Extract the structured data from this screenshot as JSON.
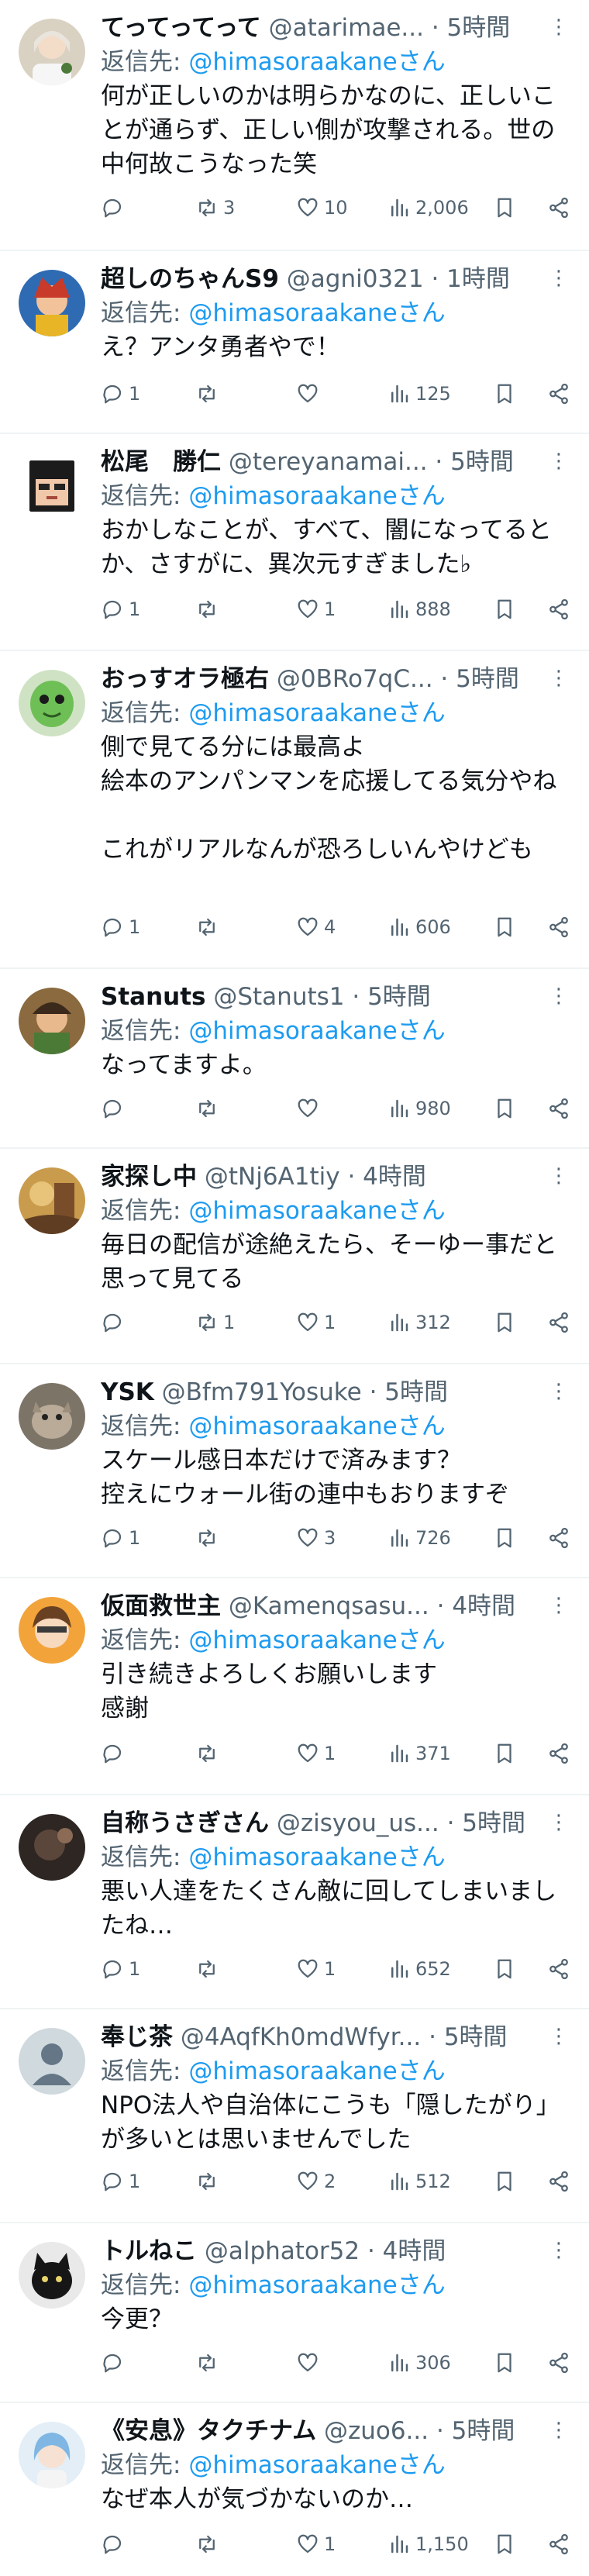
{
  "replies": [
    {
      "name": "てってってって",
      "handle": "@atarimae...",
      "time": "5時間",
      "reply_prefix": "返信先: ",
      "reply_to": "@himasoraakaneさん",
      "text": "何が正しいのかは明らかなのに、正しいことが通らず、正しい側が攻撃される。世の中何故こうなった笑",
      "replies": "",
      "retweets": "3",
      "likes": "10",
      "views": "2,006"
    },
    {
      "name": "超しのちゃんS9",
      "handle": "@agni0321",
      "time": "1時間",
      "reply_prefix": "返信先: ",
      "reply_to": "@himasoraakaneさん",
      "text": "え？アンタ勇者やで！",
      "replies": "1",
      "retweets": "",
      "likes": "",
      "views": "125"
    },
    {
      "name": "松尾　勝仁",
      "handle": "@tereyanamai...",
      "time": "5時間",
      "reply_prefix": "返信先: ",
      "reply_to": "@himasoraakaneさん",
      "text": "おかしなことが、すべて、闇になってるとか、さすがに、異次元すぎました♭",
      "replies": "1",
      "retweets": "",
      "likes": "1",
      "views": "888"
    },
    {
      "name": "おっすオラ極右",
      "handle": "@0BRo7qC...",
      "time": "5時間",
      "reply_prefix": "返信先: ",
      "reply_to": "@himasoraakaneさん",
      "text": "側で見てる分には最高よ\n絵本のアンパンマンを応援してる気分やね\n\nこれがリアルなんが恐ろしいんやけども",
      "replies": "1",
      "retweets": "",
      "likes": "4",
      "views": "606"
    },
    {
      "name": "Stanuts",
      "handle": "@Stanuts1",
      "time": "5時間",
      "reply_prefix": "返信先: ",
      "reply_to": "@himasoraakaneさん",
      "text": "なってますよ。",
      "replies": "",
      "retweets": "",
      "likes": "",
      "views": "980"
    },
    {
      "name": "家探し中",
      "handle": "@tNj6A1tiy",
      "time": "4時間",
      "reply_prefix": "返信先: ",
      "reply_to": "@himasoraakaneさん",
      "text": "毎日の配信が途絶えたら、そーゆー事だと思って見てる",
      "replies": "",
      "retweets": "1",
      "likes": "1",
      "views": "312"
    },
    {
      "name": "YSK",
      "handle": "@Bfm791Yosuke",
      "time": "5時間",
      "reply_prefix": "返信先: ",
      "reply_to": "@himasoraakaneさん",
      "text": "スケール感日本だけで済みます？\n控えにウォール街の連中もおりますぞ",
      "replies": "1",
      "retweets": "",
      "likes": "3",
      "views": "726"
    },
    {
      "name": "仮面救世主",
      "handle": "@Kamenqsasu...",
      "time": "4時間",
      "reply_prefix": "返信先: ",
      "reply_to": "@himasoraakaneさん",
      "text": "引き続きよろしくお願いします\n感謝",
      "replies": "",
      "retweets": "",
      "likes": "1",
      "views": "371"
    },
    {
      "name": "自称うさぎさん",
      "handle": "@zisyou_us...",
      "time": "5時間",
      "reply_prefix": "返信先: ",
      "reply_to": "@himasoraakaneさん",
      "text": "悪い人達をたくさん敵に回してしまいましたね…",
      "replies": "1",
      "retweets": "",
      "likes": "1",
      "views": "652"
    },
    {
      "name": "奉じ茶",
      "handle": "@4AqfKh0mdWfyr...",
      "time": "5時間",
      "reply_prefix": "返信先: ",
      "reply_to": "@himasoraakaneさん",
      "text": "NPO法人や自治体にこうも「隠したがり」が多いとは思いませんでした",
      "replies": "1",
      "retweets": "",
      "likes": "2",
      "views": "512"
    },
    {
      "name": "トルねこ",
      "handle": "@alphator52",
      "time": "4時間",
      "reply_prefix": "返信先: ",
      "reply_to": "@himasoraakaneさん",
      "text": "今更？",
      "replies": "",
      "retweets": "",
      "likes": "",
      "views": "306"
    },
    {
      "name": "《安息》タクチナム",
      "handle": "@zuo6...",
      "time": "5時間",
      "reply_prefix": "返信先: ",
      "reply_to": "@himasoraakaneさん",
      "text": "なぜ本人が気づかないのか…",
      "replies": "",
      "retweets": "",
      "likes": "1",
      "views": "1,150"
    }
  ],
  "time_separator": " · ",
  "more_glyph": "⋮",
  "colors": {
    "text": "#0f1419",
    "secondary": "#536471",
    "mention": "#1d9bf0",
    "divider": "#eff3f4"
  },
  "avatar_icons": [
    "anime-girl-avatar",
    "hero-character-avatar",
    "pixel-face-avatar",
    "green-alien-avatar",
    "game-character-avatar",
    "painting-avatar",
    "animal-photo-avatar",
    "anime-boy-avatar",
    "dark-photo-avatar",
    "default-profile-avatar",
    "black-cat-avatar",
    "blue-hair-girl-avatar"
  ]
}
